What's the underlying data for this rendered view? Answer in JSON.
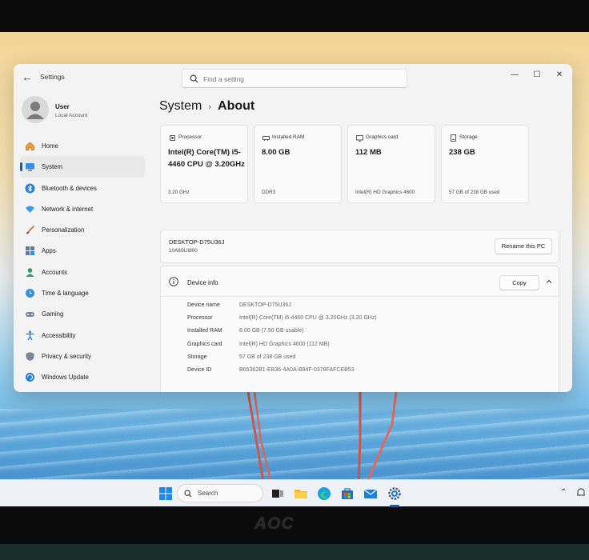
{
  "window": {
    "app_title": "Settings",
    "search_placeholder": "Find a setting",
    "controls": {
      "minimize": "—",
      "maximize": "☐",
      "close": "✕"
    }
  },
  "user": {
    "name": "User",
    "account": "Local Account"
  },
  "sidebar": {
    "items": [
      {
        "label": "Home",
        "icon": "home-icon"
      },
      {
        "label": "System",
        "icon": "monitor-icon",
        "active": true
      },
      {
        "label": "Bluetooth & devices",
        "icon": "bluetooth-icon"
      },
      {
        "label": "Network & internet",
        "icon": "wifi-icon"
      },
      {
        "label": "Personalization",
        "icon": "brush-icon"
      },
      {
        "label": "Apps",
        "icon": "apps-icon"
      },
      {
        "label": "Accounts",
        "icon": "person-icon"
      },
      {
        "label": "Time & language",
        "icon": "globe-clock-icon"
      },
      {
        "label": "Gaming",
        "icon": "gamepad-icon"
      },
      {
        "label": "Accessibility",
        "icon": "accessibility-icon"
      },
      {
        "label": "Privacy & security",
        "icon": "shield-icon"
      },
      {
        "label": "Windows Update",
        "icon": "update-icon"
      }
    ]
  },
  "breadcrumb": {
    "parent": "System",
    "separator": "›",
    "current": "About"
  },
  "cards": [
    {
      "label": "Processor",
      "value": "Intel(R) Core(TM) i5-4460 CPU @ 3.20GHz",
      "sub": "3.20 GHz",
      "icon": "processor-icon"
    },
    {
      "label": "Installed RAM",
      "value": "8.00 GB",
      "sub": "DDR3",
      "icon": "ram-icon"
    },
    {
      "label": "Graphics card",
      "value": "112 MB",
      "sub": "Intel(R) HD Graphics 4600",
      "icon": "graphics-icon"
    },
    {
      "label": "Storage",
      "value": "238 GB",
      "sub": "57 GB of 238 GB used",
      "icon": "storage-icon"
    }
  ],
  "pc": {
    "name": "DESKTOP-D75U36J",
    "model": "10A8SUI800",
    "rename_label": "Rename this PC"
  },
  "device_info": {
    "title": "Device info",
    "copy_label": "Copy",
    "specs": [
      {
        "key": "Device name",
        "value": "DESKTOP-D75U36J"
      },
      {
        "key": "Processor",
        "value": "Intel(R) Core(TM) i5-4460 CPU @ 3.20GHz (3.20 GHz)"
      },
      {
        "key": "Installed RAM",
        "value": "8.00 GB (7.90 GB usable)"
      },
      {
        "key": "Graphics card",
        "value": "Intel(R) HD Graphics 4600 (112 MB)"
      },
      {
        "key": "Storage",
        "value": "57 GB of 238 GB used"
      },
      {
        "key": "Device ID",
        "value": "B65362B1-EB36-4A0A-B94F-0378FAFCEB53"
      }
    ]
  },
  "taskbar": {
    "search_label": "Search"
  },
  "monitor": {
    "brand": "AOC"
  },
  "colors": {
    "accent": "#0067c0",
    "window_bg": "#f3f3f3",
    "card_bg": "#fafafa"
  }
}
